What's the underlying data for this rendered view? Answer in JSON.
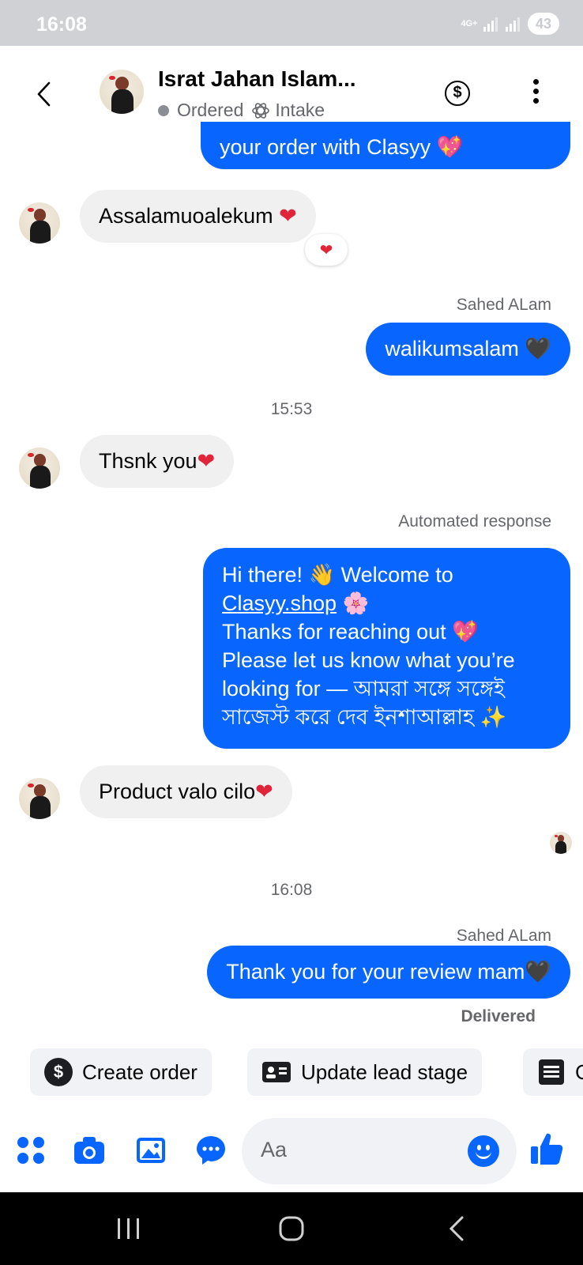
{
  "status_bar": {
    "time": "16:08",
    "network": "4G+",
    "battery": "43"
  },
  "header": {
    "contact_name": "Israt Jahan Islam...",
    "stage": "Ordered",
    "label": "Intake",
    "icons": [
      "back-icon",
      "dollar-icon",
      "more-icon"
    ]
  },
  "messages": {
    "top_fragment": "your order with Clasyy 💖",
    "m1": {
      "text": "Assalamuoalekum ",
      "heart": "❤",
      "reaction": "❤"
    },
    "m2": {
      "sender": "Sahed ALam",
      "text": "walikumsalam ",
      "heart": "🖤"
    },
    "ts1": "15:53",
    "m3": {
      "text": "Thsnk you",
      "heart": "❤"
    },
    "m4": {
      "sender": "Automated response",
      "line1": "Hi there! 👋 Welcome to",
      "link": "Clasyy.shop",
      "link_emoji": " 🌸",
      "line3": "Thanks for reaching out 💖",
      "line4": "Please let us know what you’re",
      "line5": "looking for — আমরা সঙ্গে সঙ্গেই",
      "line6": "সাজেস্ট করে দেব ইনশাআল্লাহ ✨"
    },
    "m5": {
      "text": "Product valo cilo",
      "heart": "❤"
    },
    "ts2": "16:08",
    "m6": {
      "sender": "Sahed ALam",
      "text": "Thank you for your review mam",
      "heart": "🖤"
    },
    "delivered": "Delivered"
  },
  "quick_actions": [
    {
      "label": "Create order",
      "icon": "dollar-icon"
    },
    {
      "label": "Update lead stage",
      "icon": "contact-card-icon"
    },
    {
      "label": "C",
      "icon": "list-icon"
    }
  ],
  "composer": {
    "placeholder": "Aa"
  },
  "colors": {
    "brand_blue": "#0866ff",
    "incoming_bubble": "#f0f0f0",
    "heart": "#e0243a"
  }
}
